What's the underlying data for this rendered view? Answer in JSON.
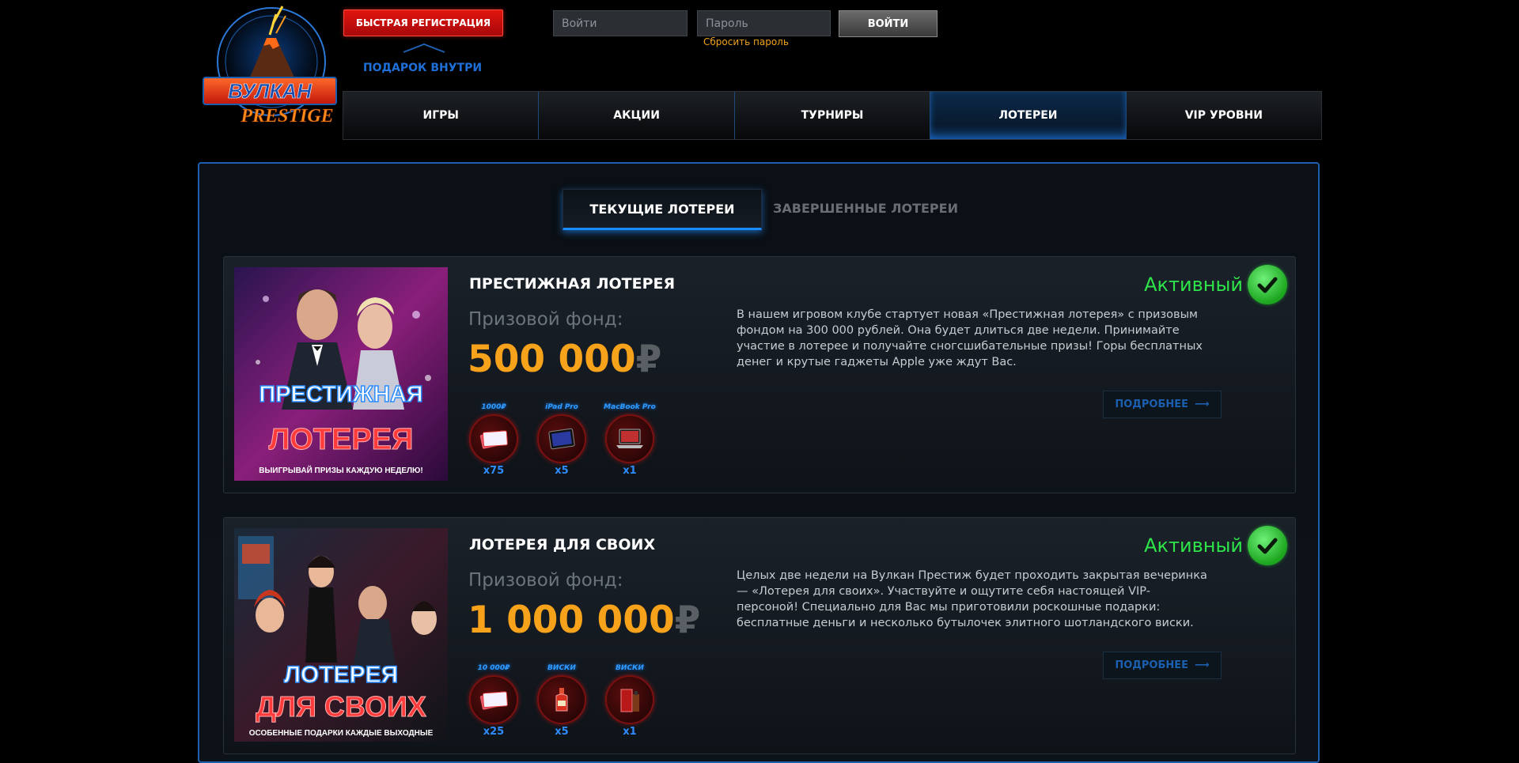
{
  "header": {
    "logo_text": [
      "ВУЛКАН",
      "PRESTIGE"
    ],
    "register_label": "БЫСТРАЯ РЕГИСТРАЦИЯ",
    "gift_label": "ПОДАРОК ВНУТРИ",
    "login_placeholder": "Войти",
    "password_placeholder": "Пароль",
    "login_button": "ВОЙТИ",
    "reset_password": "Сбросить пароль"
  },
  "nav": {
    "items": [
      "ИГРЫ",
      "АКЦИИ",
      "ТУРНИРЫ",
      "ЛОТЕРЕИ",
      "VIP УРОВНИ"
    ],
    "active": "ЛОТЕРЕИ"
  },
  "tabs": {
    "current": "ТЕКУЩИЕ ЛОТЕРЕИ",
    "finished": "ЗАВЕРШЕННЫЕ ЛОТЕРЕИ"
  },
  "lotteries": [
    {
      "title": "ПРЕСТИЖНАЯ ЛОТЕРЕЯ",
      "image_text": [
        "ПРЕСТИЖНАЯ",
        "ЛОТЕРЕЯ",
        "ВЫИГРЫВАЙ ПРИЗЫ КАЖДУЮ НЕДЕЛЮ!"
      ],
      "fund_label": "Призовой фонд:",
      "fund_value": "500 000",
      "currency": "₽",
      "status": "Активный",
      "description": "В нашем игровом клубе стартует новая «Престижная лотерея» с призовым фондом на 300 000 рублей. Она будет длиться две недели. Принимайте участие в лотерее и получайте сногсшибательные призы! Горы бесплатных денег и крутые гаджеты Apple уже ждут Вас.",
      "more": "ПОДРОБНЕЕ",
      "prizes": [
        {
          "label": "1000₽",
          "count": "x75",
          "icon": "money-icon"
        },
        {
          "label": "iPad Pro",
          "count": "x5",
          "icon": "tablet-icon"
        },
        {
          "label": "MacBook Pro",
          "count": "x1",
          "icon": "laptop-icon"
        }
      ]
    },
    {
      "title": "ЛОТЕРЕЯ ДЛЯ СВОИХ",
      "image_text": [
        "ЛОТЕРЕЯ",
        "ДЛЯ СВОИХ",
        "ОСОБЕННЫЕ ПОДАРКИ КАЖДЫЕ ВЫХОДНЫЕ"
      ],
      "fund_label": "Призовой фонд:",
      "fund_value": "1 000 000",
      "currency": "₽",
      "status": "Активный",
      "description": "Целых две недели на Вулкан Престиж будет проходить закрытая вечеринка — «Лотерея для своих». Участвуйте и ощутите себя настоящей VIP- персоной! Специально для Вас мы приготовили роскошные подарки: бесплатные деньги и несколько бутылочек элитного шотландского виски.",
      "more": "ПОДРОБНЕЕ",
      "prizes": [
        {
          "label": "10 000₽",
          "count": "x25",
          "icon": "money-icon"
        },
        {
          "label": "ВИСКИ",
          "count": "x5",
          "icon": "bottle-icon"
        },
        {
          "label": "ВИСКИ",
          "count": "x1",
          "icon": "whisky-box-icon"
        }
      ]
    }
  ],
  "colors": {
    "accent_blue": "#1b5fae",
    "gold": "#f7a21b",
    "active_green": "#2ee44a",
    "register_red": "#d8120e"
  }
}
